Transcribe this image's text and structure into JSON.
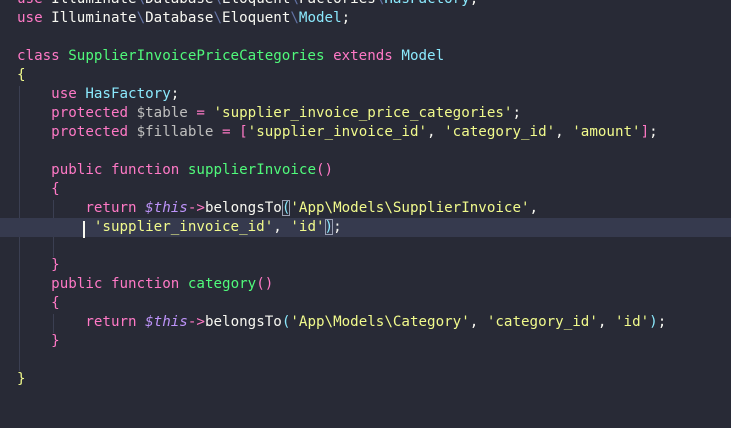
{
  "editor": {
    "language": "php",
    "lines": [
      {
        "tokens": [
          [
            "k",
            "use"
          ],
          [
            "p",
            " Illuminate"
          ],
          [
            "sep",
            "\\"
          ],
          [
            "p",
            "Database"
          ],
          [
            "sep",
            "\\"
          ],
          [
            "p",
            "Eloquent"
          ],
          [
            "sep",
            "\\"
          ],
          [
            "p",
            "Factories"
          ],
          [
            "sep",
            "\\"
          ],
          [
            "c",
            "HasFactory"
          ],
          [
            "p",
            ";"
          ]
        ]
      },
      {
        "tokens": [
          [
            "k",
            "use"
          ],
          [
            "p",
            " Illuminate"
          ],
          [
            "sep",
            "\\"
          ],
          [
            "p",
            "Database"
          ],
          [
            "sep",
            "\\"
          ],
          [
            "p",
            "Eloquent"
          ],
          [
            "sep",
            "\\"
          ],
          [
            "c",
            "Model"
          ],
          [
            "p",
            ";"
          ]
        ]
      },
      {
        "tokens": []
      },
      {
        "tokens": [
          [
            "k",
            "class"
          ],
          [
            "p",
            " "
          ],
          [
            "cls",
            "SupplierInvoicePriceCategories"
          ],
          [
            "p",
            " "
          ],
          [
            "k",
            "extends"
          ],
          [
            "p",
            " "
          ],
          [
            "c",
            "Model"
          ]
        ]
      },
      {
        "tokens": [
          [
            "b1",
            "{"
          ]
        ]
      },
      {
        "tokens": [
          [
            "p",
            "    "
          ],
          [
            "k",
            "use"
          ],
          [
            "p",
            " "
          ],
          [
            "c",
            "HasFactory"
          ],
          [
            "p",
            ";"
          ]
        ]
      },
      {
        "tokens": [
          [
            "p",
            "    "
          ],
          [
            "k",
            "protected"
          ],
          [
            "p",
            " "
          ],
          [
            "v",
            "$table"
          ],
          [
            "p",
            " "
          ],
          [
            "op",
            "="
          ],
          [
            "p",
            " "
          ],
          [
            "s",
            "'supplier_invoice_price_categories'"
          ],
          [
            "p",
            ";"
          ]
        ]
      },
      {
        "tokens": [
          [
            "p",
            "    "
          ],
          [
            "k",
            "protected"
          ],
          [
            "p",
            " "
          ],
          [
            "v",
            "$fillable"
          ],
          [
            "p",
            " "
          ],
          [
            "op",
            "="
          ],
          [
            "p",
            " "
          ],
          [
            "b2",
            "["
          ],
          [
            "s",
            "'supplier_invoice_id'"
          ],
          [
            "p",
            ", "
          ],
          [
            "s",
            "'category_id'"
          ],
          [
            "p",
            ", "
          ],
          [
            "s",
            "'amount'"
          ],
          [
            "b2",
            "]"
          ],
          [
            "p",
            ";"
          ]
        ]
      },
      {
        "tokens": []
      },
      {
        "tokens": [
          [
            "p",
            "    "
          ],
          [
            "k",
            "public"
          ],
          [
            "p",
            " "
          ],
          [
            "k",
            "function"
          ],
          [
            "p",
            " "
          ],
          [
            "f",
            "supplierInvoice"
          ],
          [
            "b2",
            "()"
          ]
        ]
      },
      {
        "tokens": [
          [
            "p",
            "    "
          ],
          [
            "b2",
            "{"
          ]
        ]
      },
      {
        "tokens": [
          [
            "p",
            "        "
          ],
          [
            "k",
            "return"
          ],
          [
            "p",
            " "
          ],
          [
            "vi",
            "$this"
          ],
          [
            "op",
            "->"
          ],
          [
            "m",
            "belongsTo"
          ],
          [
            "b3",
            "(",
            "match"
          ],
          [
            "s",
            "'App\\Models\\SupplierInvoice'"
          ],
          [
            "p",
            ","
          ]
        ]
      },
      {
        "tokens": [
          [
            "p",
            "        "
          ],
          [
            "s",
            " 'supplier_invoice_id'"
          ],
          [
            "p",
            ", "
          ],
          [
            "s",
            "'id'"
          ],
          [
            "b3",
            ")",
            "match"
          ],
          [
            "p",
            ";"
          ]
        ],
        "current": true
      },
      {
        "tokens": []
      },
      {
        "tokens": [
          [
            "p",
            "    "
          ],
          [
            "b2",
            "}"
          ]
        ]
      },
      {
        "tokens": [
          [
            "p",
            "    "
          ],
          [
            "k",
            "public"
          ],
          [
            "p",
            " "
          ],
          [
            "k",
            "function"
          ],
          [
            "p",
            " "
          ],
          [
            "f",
            "category"
          ],
          [
            "b2",
            "()"
          ]
        ]
      },
      {
        "tokens": [
          [
            "p",
            "    "
          ],
          [
            "b2",
            "{"
          ]
        ]
      },
      {
        "tokens": [
          [
            "p",
            "        "
          ],
          [
            "k",
            "return"
          ],
          [
            "p",
            " "
          ],
          [
            "vi",
            "$this"
          ],
          [
            "op",
            "->"
          ],
          [
            "m",
            "belongsTo"
          ],
          [
            "b3",
            "("
          ],
          [
            "s",
            "'App\\Models\\Category'"
          ],
          [
            "p",
            ", "
          ],
          [
            "s",
            "'category_id'"
          ],
          [
            "p",
            ", "
          ],
          [
            "s",
            "'id'"
          ],
          [
            "b3",
            ")"
          ],
          [
            "p",
            ";"
          ]
        ]
      },
      {
        "tokens": [
          [
            "p",
            "    "
          ],
          [
            "b2",
            "}"
          ]
        ]
      },
      {
        "tokens": []
      },
      {
        "tokens": [
          [
            "b1",
            "}"
          ]
        ]
      }
    ]
  },
  "colors": {
    "background": "#282a36",
    "current_line": "#363a4e",
    "keyword": "#ff79c6",
    "string": "#f1fa8c",
    "class_name": "#50fa7b",
    "type": "#8be9fd",
    "variable_this": "#bd93f9"
  }
}
